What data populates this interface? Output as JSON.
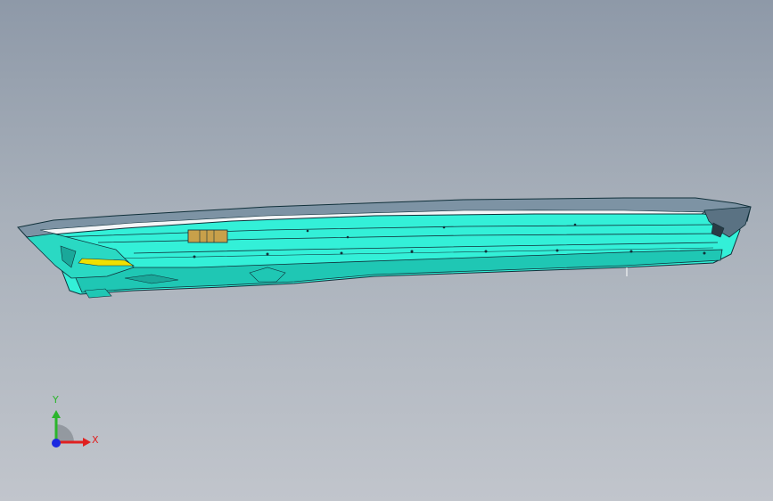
{
  "viewport": {
    "background_top": "#8e99a8",
    "background_bottom": "#c1c5cc"
  },
  "model": {
    "icon": "cad-part-model",
    "primary_color": "#33f0d8",
    "shade_color": "#1fc7b4",
    "edge_color": "#10303a",
    "accent_color": "#f0e000",
    "tab_color": "#c8a04a"
  },
  "triad": {
    "icon": "coordinate-triad",
    "y_label": "Y",
    "x_label": "X",
    "y_color": "#2bb52b",
    "x_color": "#e02020",
    "z_color": "#1a28e0"
  }
}
